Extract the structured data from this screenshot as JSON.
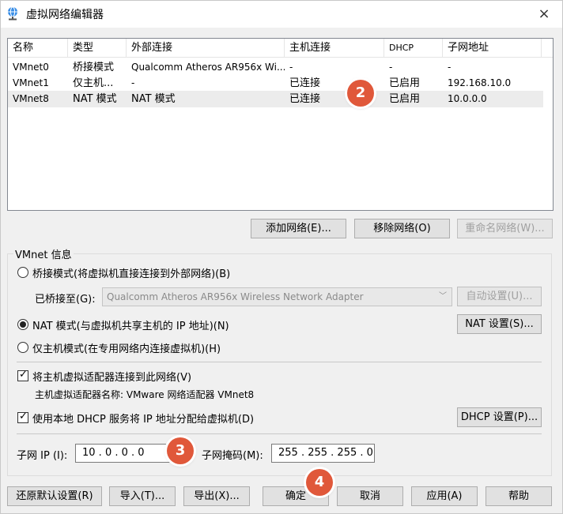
{
  "window": {
    "title": "虚拟网络编辑器",
    "close_icon": "×"
  },
  "table": {
    "columns": [
      "名称",
      "类型",
      "外部连接",
      "主机连接",
      "DHCP",
      "子网地址"
    ],
    "rows": [
      {
        "name": "VMnet0",
        "type": "桥接模式",
        "external": "Qualcomm Atheros AR956x Wi...",
        "host": "-",
        "dhcp": "-",
        "subnet": "-"
      },
      {
        "name": "VMnet1",
        "type": "仅主机...",
        "external": "-",
        "host": "已连接",
        "dhcp": "已启用",
        "subnet": "192.168.10.0"
      },
      {
        "name": "VMnet8",
        "type": "NAT 模式",
        "external": "NAT 模式",
        "host": "已连接",
        "dhcp": "已启用",
        "subnet": "10.0.0.0"
      }
    ]
  },
  "table_buttons": {
    "add": "添加网络(E)...",
    "remove": "移除网络(O)",
    "rename": "重命名网络(W)..."
  },
  "info": {
    "group_label": "VMnet 信息",
    "bridged_label": "桥接模式(将虚拟机直接连接到外部网络)(B)",
    "bridged_to_label": "已桥接至(G):",
    "bridged_to_value": "Qualcomm Atheros AR956x Wireless Network Adapter",
    "auto_settings": "自动设置(U)...",
    "nat_label": "NAT 模式(与虚拟机共享主机的 IP 地址)(N)",
    "nat_settings": "NAT 设置(S)...",
    "hostonly_label": "仅主机模式(在专用网络内连接虚拟机)(H)",
    "connect_adapter_label": "将主机虚拟适配器连接到此网络(V)",
    "adapter_name_label": "主机虚拟适配器名称: VMware 网络适配器 VMnet8",
    "dhcp_label": "使用本地 DHCP 服务将 IP 地址分配给虚拟机(D)",
    "dhcp_settings": "DHCP 设置(P)...",
    "subnet_ip_label": "子网 IP (I):",
    "subnet_ip_value": "10 . 0 . 0 . 0",
    "subnet_mask_label": "子网掩码(M):",
    "subnet_mask_value": "255 . 255 . 255 . 0"
  },
  "footer_buttons": {
    "restore": "还原默认设置(R)",
    "import": "导入(T)...",
    "export": "导出(X)...",
    "ok": "确定",
    "cancel": "取消",
    "apply": "应用(A)",
    "help": "帮助"
  },
  "badges": [
    "2",
    "3",
    "4"
  ],
  "colors": {
    "badge": "#e0583a",
    "selected_row": "#ececec"
  }
}
